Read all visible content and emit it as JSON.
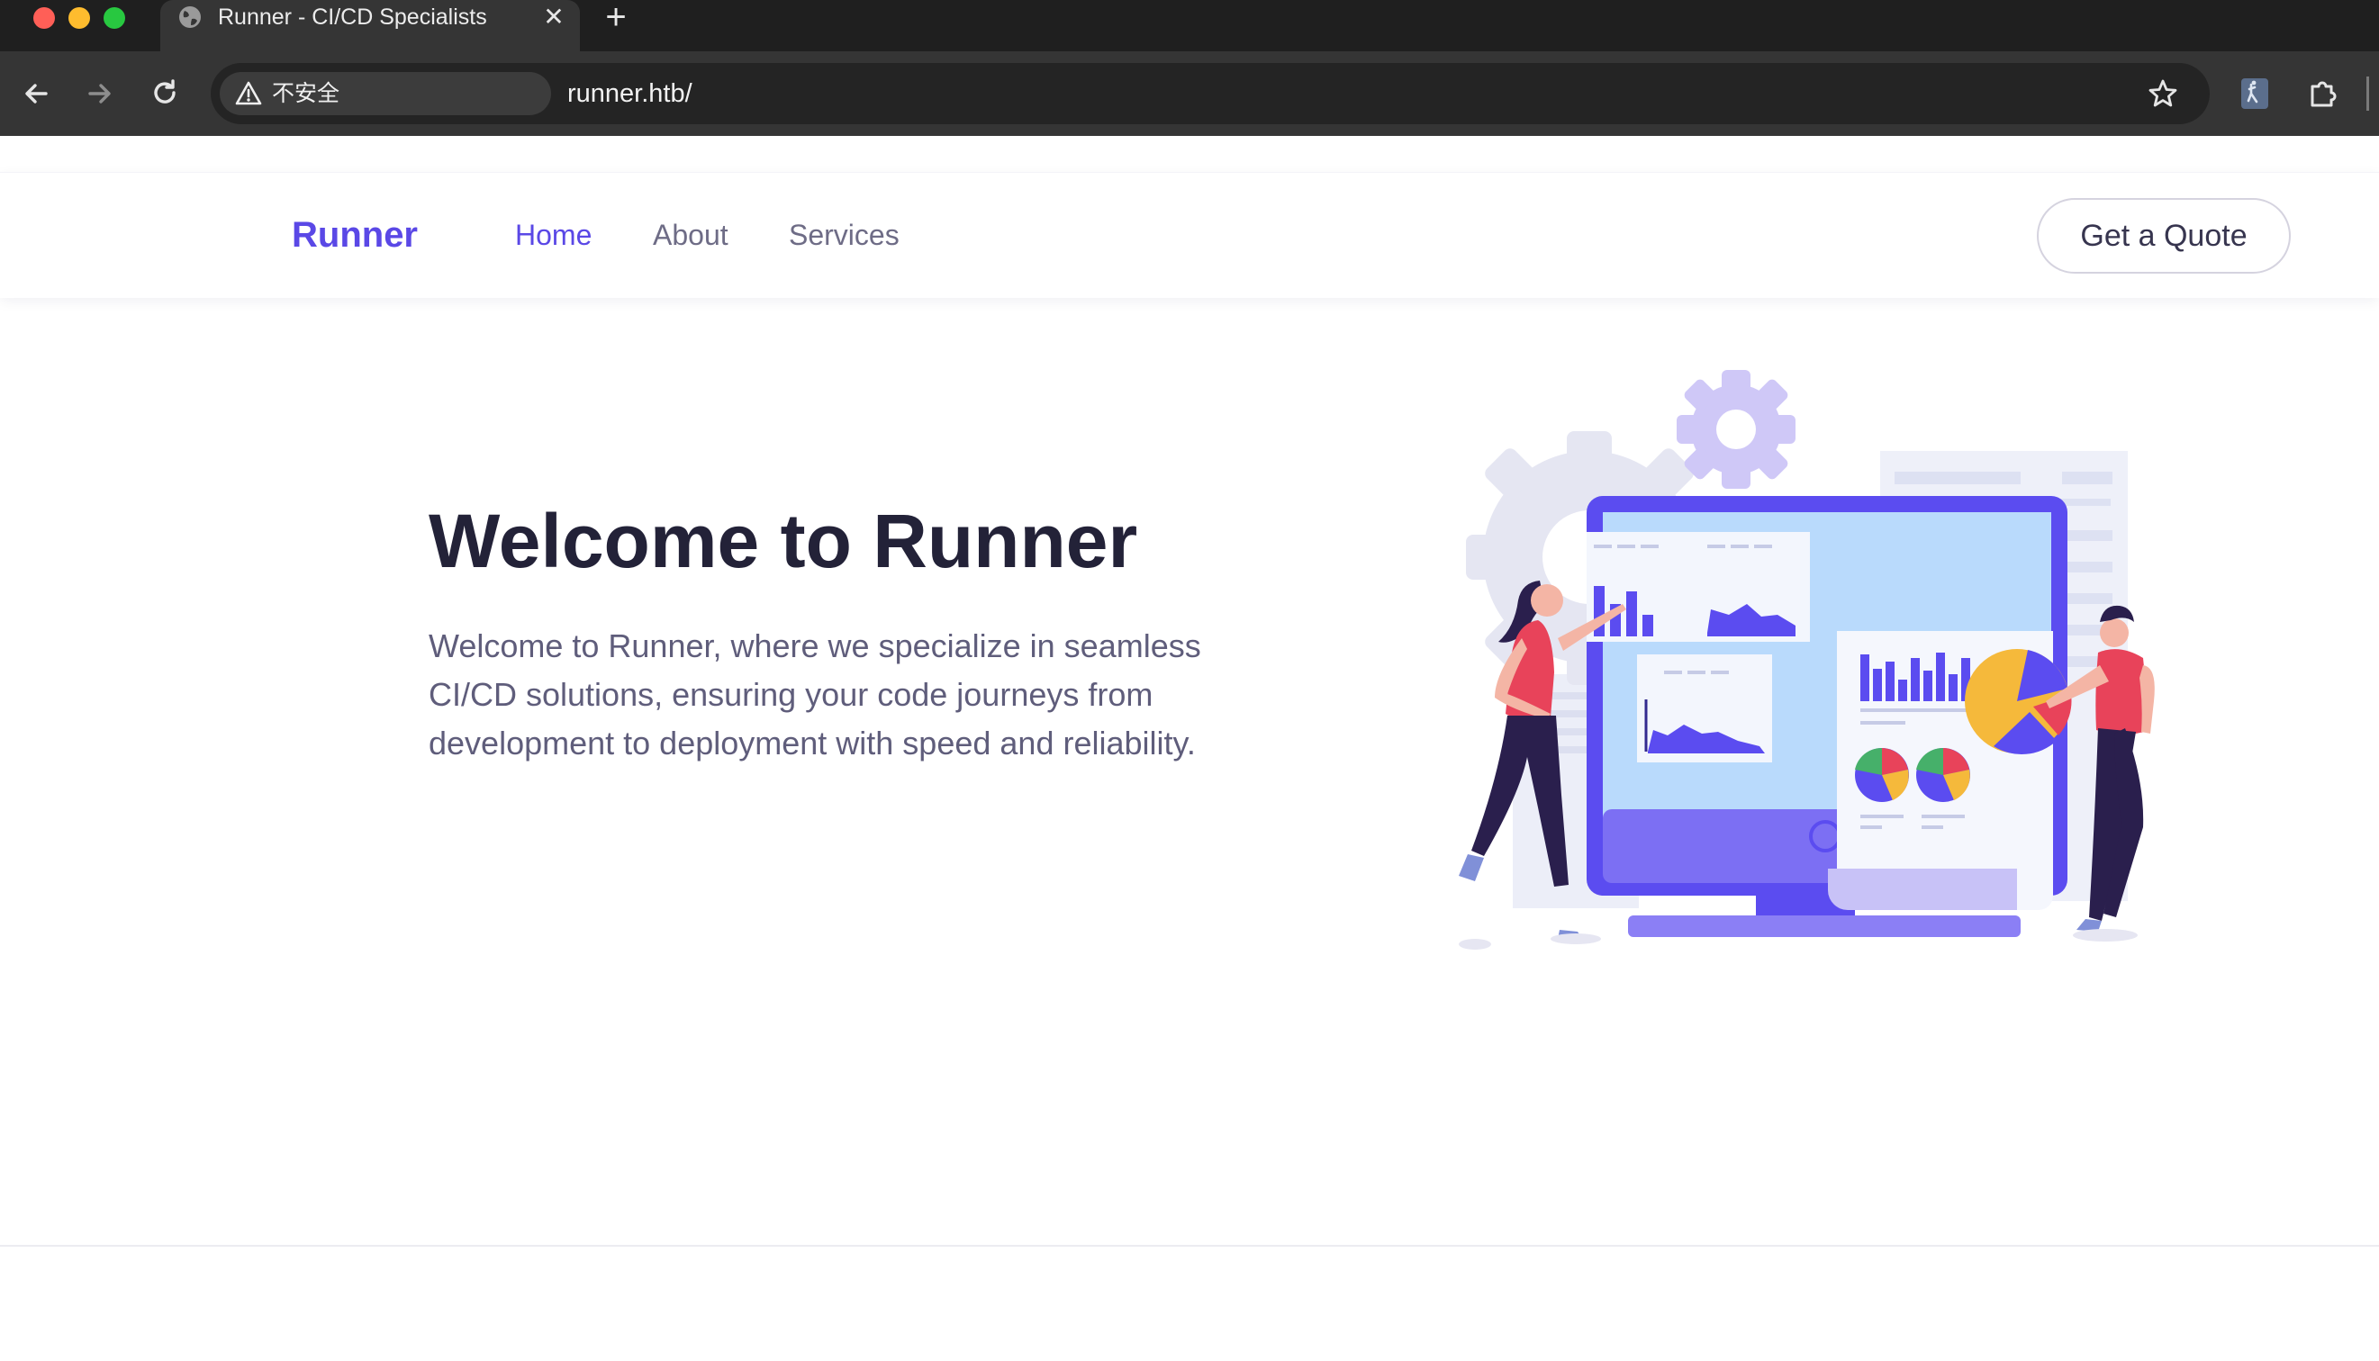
{
  "browser": {
    "tab": {
      "title": "Runner - CI/CD Specialists",
      "close_label": "✕"
    },
    "new_tab_label": "+",
    "security_chip": "不安全",
    "url": "runner.htb/"
  },
  "site": {
    "brand": "Runner",
    "nav": [
      {
        "label": "Home",
        "active": true
      },
      {
        "label": "About",
        "active": false
      },
      {
        "label": "Services",
        "active": false
      }
    ],
    "cta": "Get a Quote"
  },
  "hero": {
    "title": "Welcome to Runner",
    "lines": [
      "Welcome to Runner, where we specialize in seamless",
      "CI/CD solutions, ensuring your code journeys from",
      "development to deployment with speed and reliability."
    ],
    "illustration": "ci-cd-dashboard-illustration"
  },
  "colors": {
    "accent": "#5a48e6",
    "chrome_dark": "#1f1f1f",
    "chrome_toolbar": "#353535",
    "heading": "#232238",
    "body_text": "#5f5d7b",
    "illustration_primary": "#5b4cf0",
    "illustration_red": "#e8435a",
    "illustration_yellow": "#f5b93b"
  },
  "icons": {
    "tab": "globe-icon",
    "back": "arrow-left-icon",
    "forward": "arrow-right-icon",
    "reload": "reload-icon",
    "warning": "warning-triangle-icon",
    "bookmark": "star-icon",
    "extension": "puzzle-piece-icon"
  }
}
